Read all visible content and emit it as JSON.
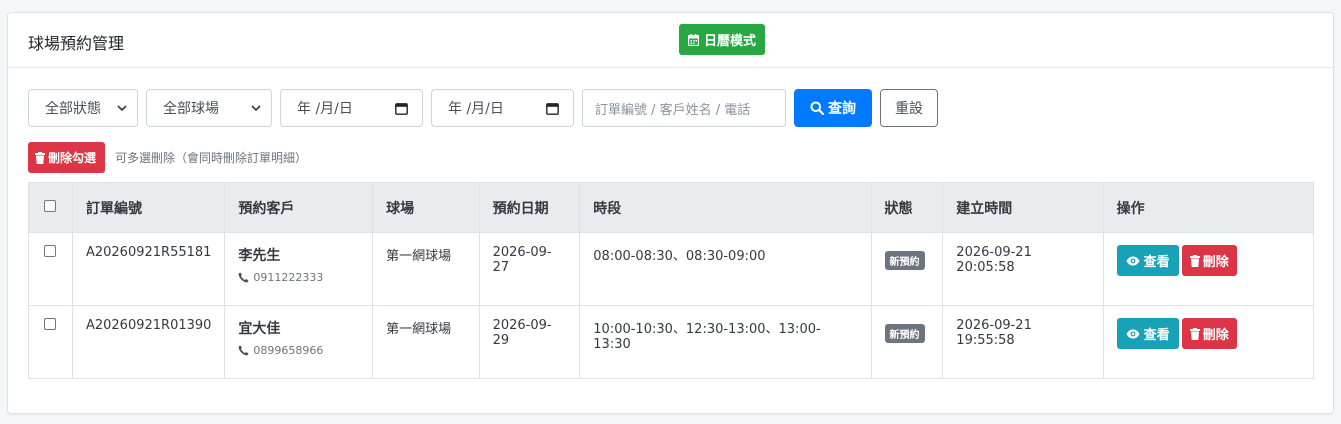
{
  "header": {
    "title": "球場預約管理",
    "calendar_button": "日曆模式"
  },
  "filters": {
    "status_selected": "全部狀態",
    "court_selected": "全部球場",
    "date_from": "年 /月/日",
    "date_to": "年 /月/日",
    "search_placeholder": "訂單編號 / 客戶姓名 / 電話",
    "query_button": "查詢",
    "reset_button": "重設"
  },
  "bulk": {
    "delete_selected": "刪除勾選",
    "hint": "可多選刪除（會同時刪除訂單明細）"
  },
  "table": {
    "headers": [
      "訂單編號",
      "預約客戶",
      "球場",
      "預約日期",
      "時段",
      "狀態",
      "建立時間",
      "操作"
    ],
    "rows": [
      {
        "order_no": "A20260921R55181",
        "customer": "李先生",
        "phone": "0911222333",
        "court": "第一網球場",
        "date": "2026-09-27",
        "slots": "08:00-08:30、08:30-09:00",
        "status": "新預約",
        "created": "2026-09-21 20:05:58"
      },
      {
        "order_no": "A20260921R01390",
        "customer": "宜大佳",
        "phone": "0899658966",
        "court": "第一網球場",
        "date": "2026-09-29",
        "slots": "10:00-10:30、12:30-13:00、13:00-13:30",
        "status": "新預約",
        "created": "2026-09-21 19:55:58"
      }
    ],
    "view_label": "查看",
    "delete_label": "刪除"
  },
  "colors": {
    "primary": "#007bff",
    "success": "#28a745",
    "danger": "#dc3545",
    "info": "#17a2b8",
    "badge": "#6c757d"
  }
}
